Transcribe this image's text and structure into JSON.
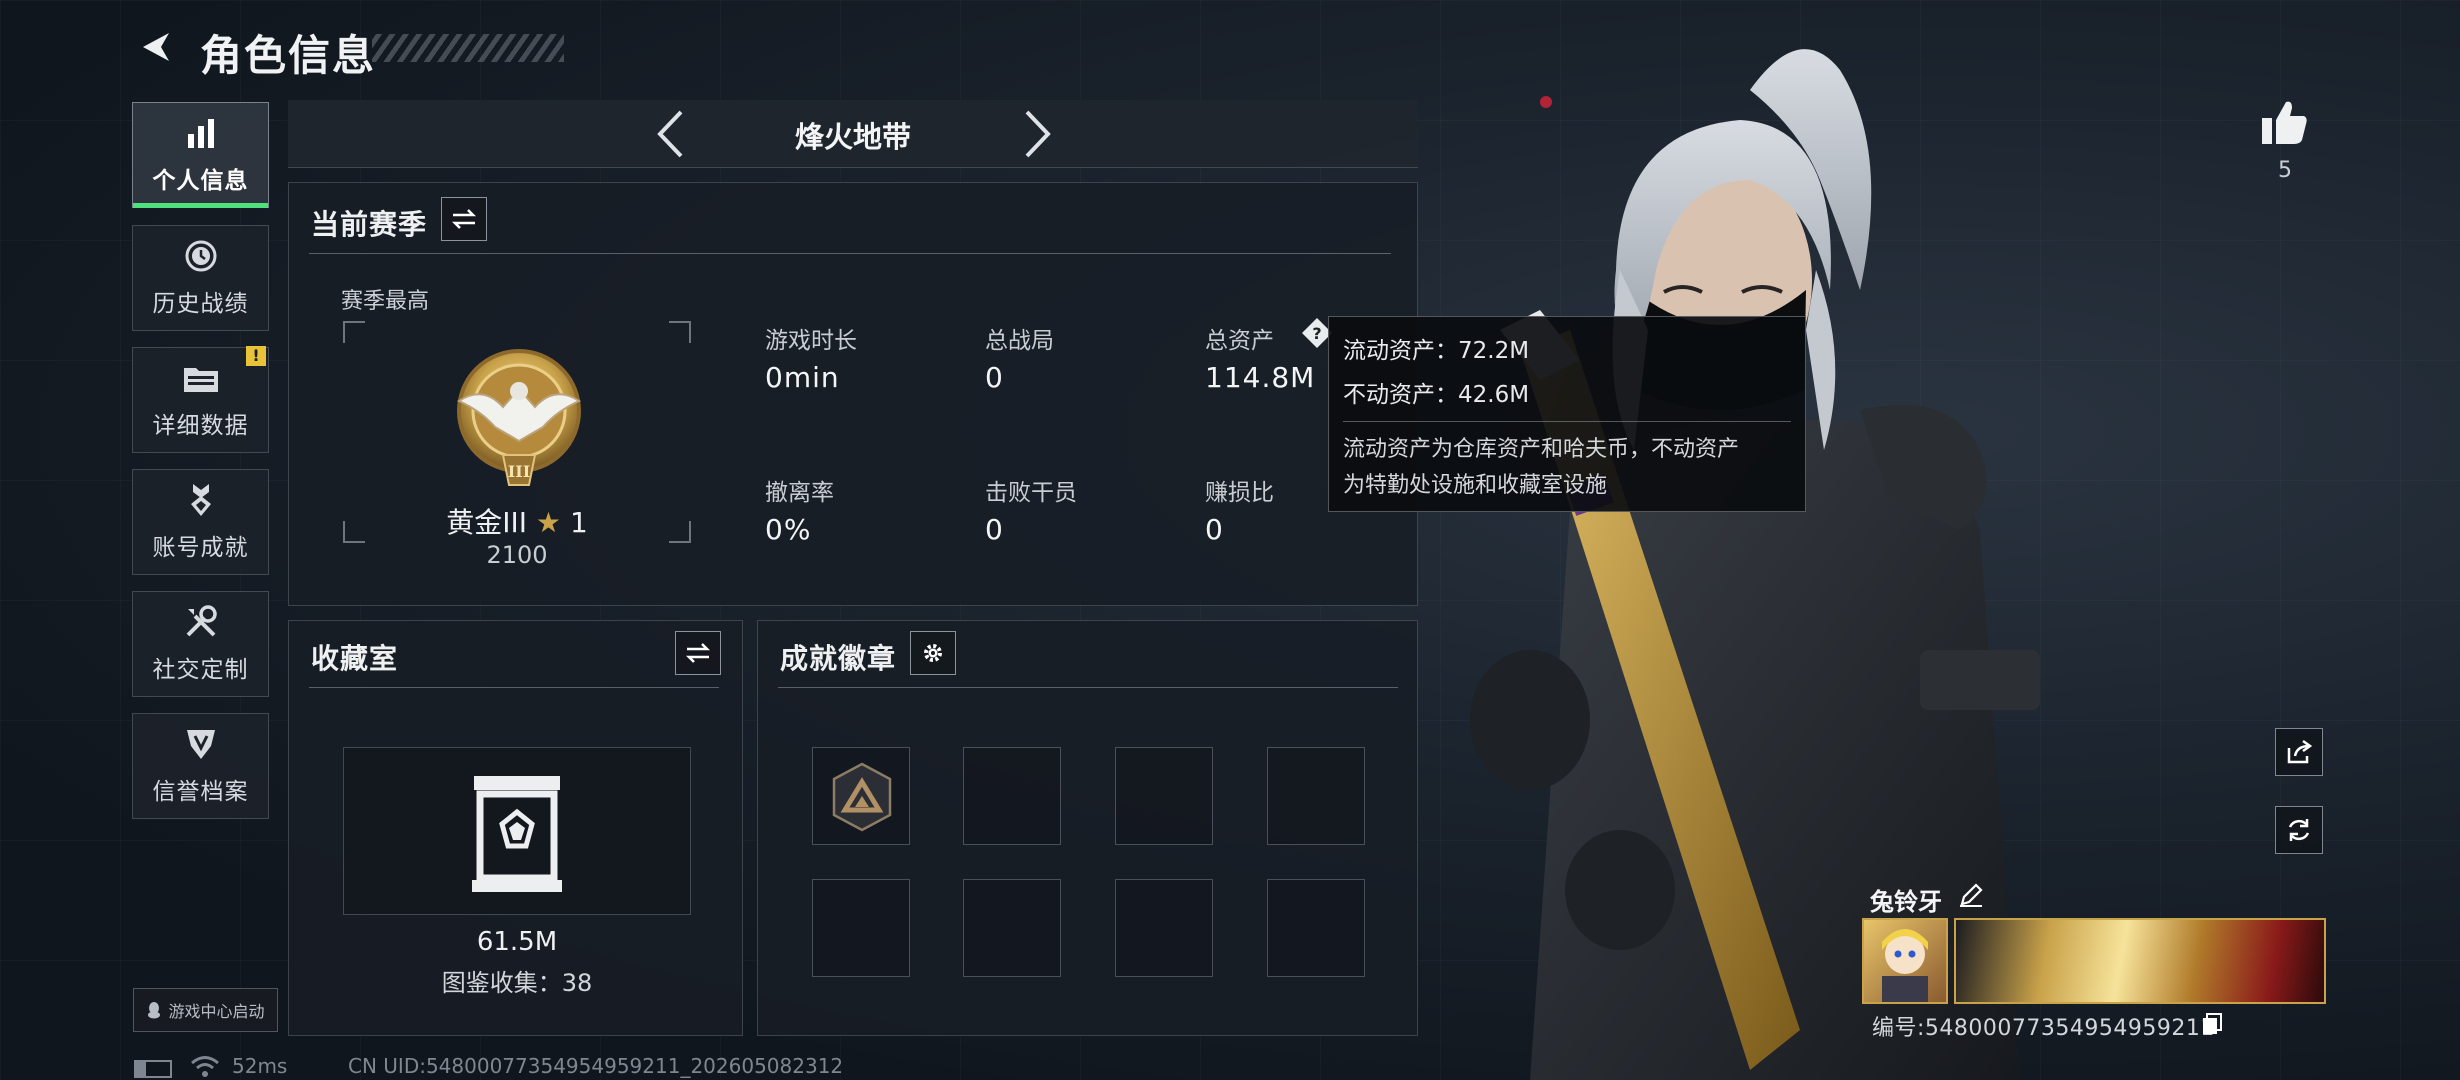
{
  "header": {
    "title": "角色信息",
    "back_icon": "back-arrow-icon"
  },
  "sidebar": {
    "items": [
      {
        "label": "个人信息",
        "icon": "bar-chart-icon",
        "active": true
      },
      {
        "label": "历史战绩",
        "icon": "history-clock-icon"
      },
      {
        "label": "详细数据",
        "icon": "folder-icon",
        "badge": "!"
      },
      {
        "label": "账号成就",
        "icon": "medal-icon"
      },
      {
        "label": "社交定制",
        "icon": "wrench-screwdriver-icon"
      },
      {
        "label": "信誉档案",
        "icon": "shield-badge-icon"
      }
    ]
  },
  "mode": {
    "title": "烽火地带"
  },
  "season": {
    "title": "当前赛季",
    "best_label": "赛季最高",
    "rank_name": "黄金III",
    "rank_stars": "1",
    "rank_points": "2100",
    "stats": [
      {
        "label": "游戏时长",
        "value": "0min"
      },
      {
        "label": "总战局",
        "value": "0"
      },
      {
        "label": "总资产",
        "value": "114.8M",
        "has_help": true
      },
      {
        "label": "撤离率",
        "value": "0%"
      },
      {
        "label": "击败干员",
        "value": "0"
      },
      {
        "label": "赚损比",
        "value": "0"
      }
    ]
  },
  "tooltip": {
    "liquid": "流动资产：72.2M",
    "fixed": "不动资产：42.6M",
    "desc_line1": "流动资产为仓库资产和哈夫币，不动资产",
    "desc_line2": "为特勤处设施和收藏室设施"
  },
  "collection": {
    "title": "收藏室",
    "value": "61.5M",
    "catalog": "图鉴收集：38"
  },
  "badges": {
    "title": "成就徽章"
  },
  "likes": {
    "count": "5"
  },
  "player": {
    "name": "兔铃牙",
    "id": "编号:548000773549549592​11"
  },
  "footer": {
    "launcher": "游戏中心启动",
    "ping": "52ms",
    "uid": "CN UID:548000773549549592​11_202605082312"
  },
  "colors": {
    "accent": "#4ee07c",
    "warn": "#e8c33a",
    "gold": "#c9a24a"
  }
}
